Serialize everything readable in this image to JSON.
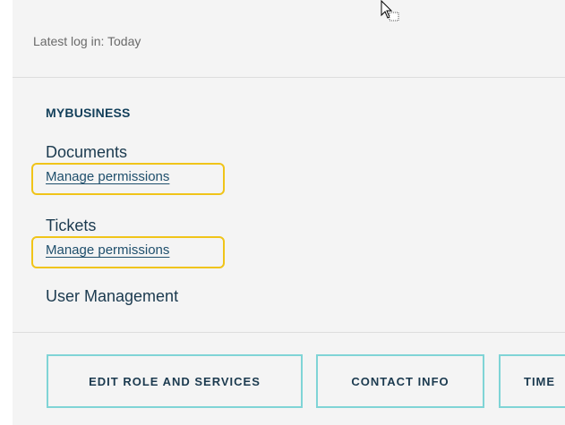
{
  "login": {
    "text": "Latest log in: Today"
  },
  "section": {
    "title": "MYBUSINESS"
  },
  "items": [
    {
      "label": "Documents",
      "link": "Manage permissions"
    },
    {
      "label": "Tickets",
      "link": "Manage permissions"
    },
    {
      "label": "User Management"
    }
  ],
  "buttons": [
    {
      "label": "EDIT ROLE AND SERVICES"
    },
    {
      "label": "CONTACT INFO"
    },
    {
      "label": "TIME"
    }
  ],
  "colors": {
    "accent_border": "#7fd4d6",
    "highlight": "#f0c419",
    "text_dark": "#1b3a4f"
  }
}
